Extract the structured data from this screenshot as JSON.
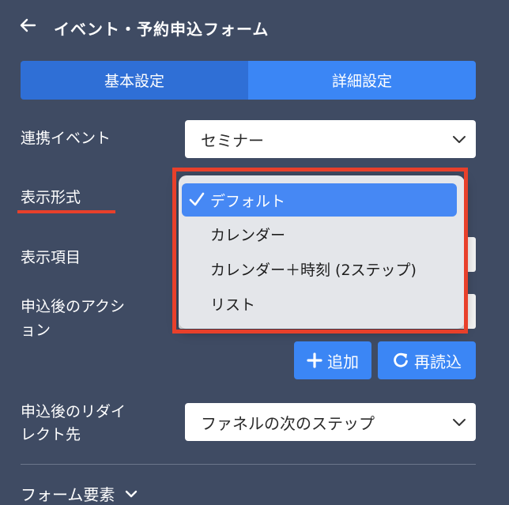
{
  "header": {
    "back_icon": "arrow-left-icon",
    "title": "イベント・予約申込フォーム"
  },
  "tabs": [
    {
      "label": "基本設定",
      "active": false
    },
    {
      "label": "詳細設定",
      "active": true
    }
  ],
  "fields": {
    "linked_event": {
      "label": "連携イベント",
      "value": "セミナー"
    },
    "display_format": {
      "label": "表示形式"
    },
    "display_items": {
      "label": "表示項目"
    },
    "post_action": {
      "label_line1": "申込後のアクシ",
      "label_line2": "ョン"
    },
    "redirect": {
      "label_line1": "申込後のリダイ",
      "label_line2": "レクト先",
      "value": "ファネルの次のステップ"
    }
  },
  "dropdown": {
    "options": [
      {
        "label": "デフォルト",
        "selected": true
      },
      {
        "label": "カレンダー",
        "selected": false
      },
      {
        "label": "カレンダー＋時刻 (2ステップ)",
        "selected": false
      },
      {
        "label": "リスト",
        "selected": false
      }
    ]
  },
  "buttons": {
    "add": {
      "label": "追加",
      "icon": "plus-icon"
    },
    "reload": {
      "label": "再読込",
      "icon": "reload-icon"
    }
  },
  "footer": {
    "label": "フォーム要素",
    "icon": "chevron-down-icon"
  },
  "colors": {
    "background": "#3f4b63",
    "tab_active": "#3b86f5",
    "tab_inactive": "#2f6fd6",
    "highlight": "#e8402b",
    "option_selected": "#4688f4"
  }
}
